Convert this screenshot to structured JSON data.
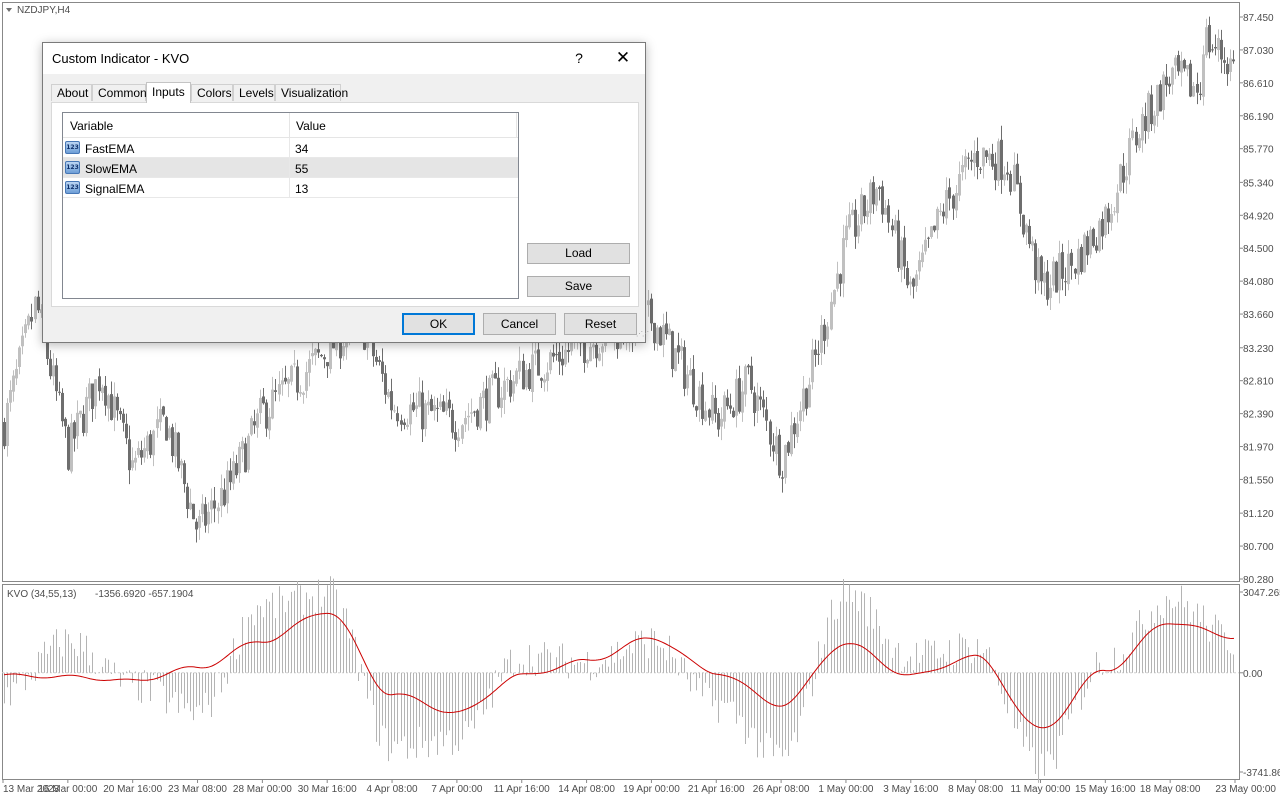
{
  "chart": {
    "symbol_label": "NZDJPY,H4",
    "indicator_label": "KVO (34,55,13)",
    "indicator_values": "-1356.6920 -657.1904",
    "price_ticks": [
      "87.450",
      "87.030",
      "86.610",
      "86.190",
      "85.770",
      "85.340",
      "84.920",
      "84.500",
      "84.080",
      "83.660",
      "83.230",
      "82.810",
      "82.390",
      "81.970",
      "81.550",
      "81.120",
      "80.700",
      "80.280"
    ],
    "indicator_ticks": [
      "3047.265",
      "0.00",
      "-3741.86"
    ],
    "time_labels": [
      "13 Mar 2023",
      "16 Mar 00:00",
      "20 Mar 16:00",
      "23 Mar 08:00",
      "28 Mar 00:00",
      "30 Mar 16:00",
      "4 Apr 08:00",
      "7 Apr 00:00",
      "11 Apr 16:00",
      "14 Apr 08:00",
      "19 Apr 00:00",
      "21 Apr 16:00",
      "26 Apr 08:00",
      "1 May 00:00",
      "3 May 16:00",
      "8 May 08:00",
      "11 May 00:00",
      "15 May 16:00",
      "18 May 08:00",
      "23 May 00:00"
    ],
    "colors": {
      "bull_candle": "#c0c0c0",
      "bear_candle": "#6e6e6e",
      "signal_line": "#cc0000",
      "histogram": "#b4b4b4",
      "grid": "#ffffff"
    }
  },
  "chart_data": [
    {
      "type": "candlestick",
      "title": "NZDJPY,H4",
      "ylim": [
        80.28,
        87.45
      ],
      "xlim": [
        "13 Mar 2023",
        "23 May 00:00"
      ],
      "close_path": [
        [
          "13 Mar 2023",
          82.2
        ],
        [
          "14 Mar 08:00",
          83.8
        ],
        [
          "16 Mar 00:00",
          81.9
        ],
        [
          "17 Mar 12:00",
          82.9
        ],
        [
          "20 Mar 16:00",
          81.7
        ],
        [
          "22 Mar 00:00",
          82.3
        ],
        [
          "23 Mar 08:00",
          80.9
        ],
        [
          "24 Mar 16:00",
          81.5
        ],
        [
          "28 Mar 00:00",
          82.4
        ],
        [
          "30 Mar 16:00",
          83.2
        ],
        [
          "31 Mar 16:00",
          83.6
        ],
        [
          "4 Apr 08:00",
          82.5
        ],
        [
          "7 Apr 00:00",
          82.3
        ],
        [
          "11 Apr 16:00",
          82.9
        ],
        [
          "14 Apr 08:00",
          83.3
        ],
        [
          "19 Apr 00:00",
          83.6
        ],
        [
          "21 Apr 16:00",
          82.3
        ],
        [
          "24 Apr 16:00",
          82.8
        ],
        [
          "26 Apr 08:00",
          81.8
        ],
        [
          "28 Apr 00:00",
          83.0
        ],
        [
          "1 May 00:00",
          84.6
        ],
        [
          "2 May 08:00",
          85.3
        ],
        [
          "3 May 16:00",
          83.9
        ],
        [
          "5 May 00:00",
          85.0
        ],
        [
          "8 May 08:00",
          85.7
        ],
        [
          "9 May 16:00",
          85.6
        ],
        [
          "11 May 00:00",
          84.0
        ],
        [
          "12 May 08:00",
          84.3
        ],
        [
          "15 May 16:00",
          84.9
        ],
        [
          "17 May 00:00",
          86.0
        ],
        [
          "18 May 08:00",
          86.7
        ],
        [
          "19 May 16:00",
          86.5
        ],
        [
          "22 May 08:00",
          87.2
        ],
        [
          "23 May 00:00",
          86.8
        ]
      ]
    },
    {
      "type": "bar+line",
      "title": "KVO (34,55,13)",
      "ylim": [
        -3741.86,
        3047.265
      ],
      "series": [
        {
          "name": "KVO",
          "points": [
            [
              "13 Mar 2023",
              -800
            ],
            [
              "16 Mar 00:00",
              1200
            ],
            [
              "20 Mar 16:00",
              -500
            ],
            [
              "23 Mar 08:00",
              -1500
            ],
            [
              "28 Mar 00:00",
              2500
            ],
            [
              "30 Mar 16:00",
              3000
            ],
            [
              "4 Apr 08:00",
              -2800
            ],
            [
              "7 Apr 00:00",
              -2500
            ],
            [
              "11 Apr 16:00",
              600
            ],
            [
              "14 Apr 08:00",
              400
            ],
            [
              "19 Apr 00:00",
              1200
            ],
            [
              "21 Apr 16:00",
              -1200
            ],
            [
              "26 Apr 08:00",
              -3200
            ],
            [
              "1 May 00:00",
              3000
            ],
            [
              "3 May 16:00",
              600
            ],
            [
              "8 May 08:00",
              1000
            ],
            [
              "11 May 00:00",
              -3600
            ],
            [
              "15 May 16:00",
              500
            ],
            [
              "18 May 08:00",
              2800
            ],
            [
              "23 May 00:00",
              1200
            ]
          ]
        },
        {
          "name": "Signal",
          "points": [
            [
              "13 Mar 2023",
              -100
            ],
            [
              "16 Mar 00:00",
              -150
            ],
            [
              "20 Mar 16:00",
              -300
            ],
            [
              "23 Mar 08:00",
              200
            ],
            [
              "28 Mar 00:00",
              1200
            ],
            [
              "30 Mar 16:00",
              2300
            ],
            [
              "4 Apr 08:00",
              -800
            ],
            [
              "7 Apr 00:00",
              -1500
            ],
            [
              "11 Apr 16:00",
              -100
            ],
            [
              "14 Apr 08:00",
              450
            ],
            [
              "19 Apr 00:00",
              1300
            ],
            [
              "21 Apr 16:00",
              0
            ],
            [
              "26 Apr 08:00",
              -1200
            ],
            [
              "1 May 00:00",
              1100
            ],
            [
              "3 May 16:00",
              -100
            ],
            [
              "8 May 08:00",
              600
            ],
            [
              "11 May 00:00",
              -2100
            ],
            [
              "15 May 16:00",
              100
            ],
            [
              "18 May 08:00",
              1900
            ],
            [
              "23 May 00:00",
              1350
            ]
          ]
        }
      ]
    }
  ],
  "dialog": {
    "title": "Custom Indicator - KVO",
    "help_label": "?",
    "close_label": "✕",
    "tabs": [
      "About",
      "Common",
      "Inputs",
      "Colors",
      "Levels",
      "Visualization"
    ],
    "active_tab": "Inputs",
    "table": {
      "col_variable": "Variable",
      "col_value": "Value",
      "icon_text": "123",
      "rows": [
        {
          "variable": "FastEMA",
          "value": "34"
        },
        {
          "variable": "SlowEMA",
          "value": "55"
        },
        {
          "variable": "SignalEMA",
          "value": "13"
        }
      ]
    },
    "load_label": "Load",
    "save_label": "Save",
    "ok_label": "OK",
    "cancel_label": "Cancel",
    "reset_label": "Reset"
  }
}
